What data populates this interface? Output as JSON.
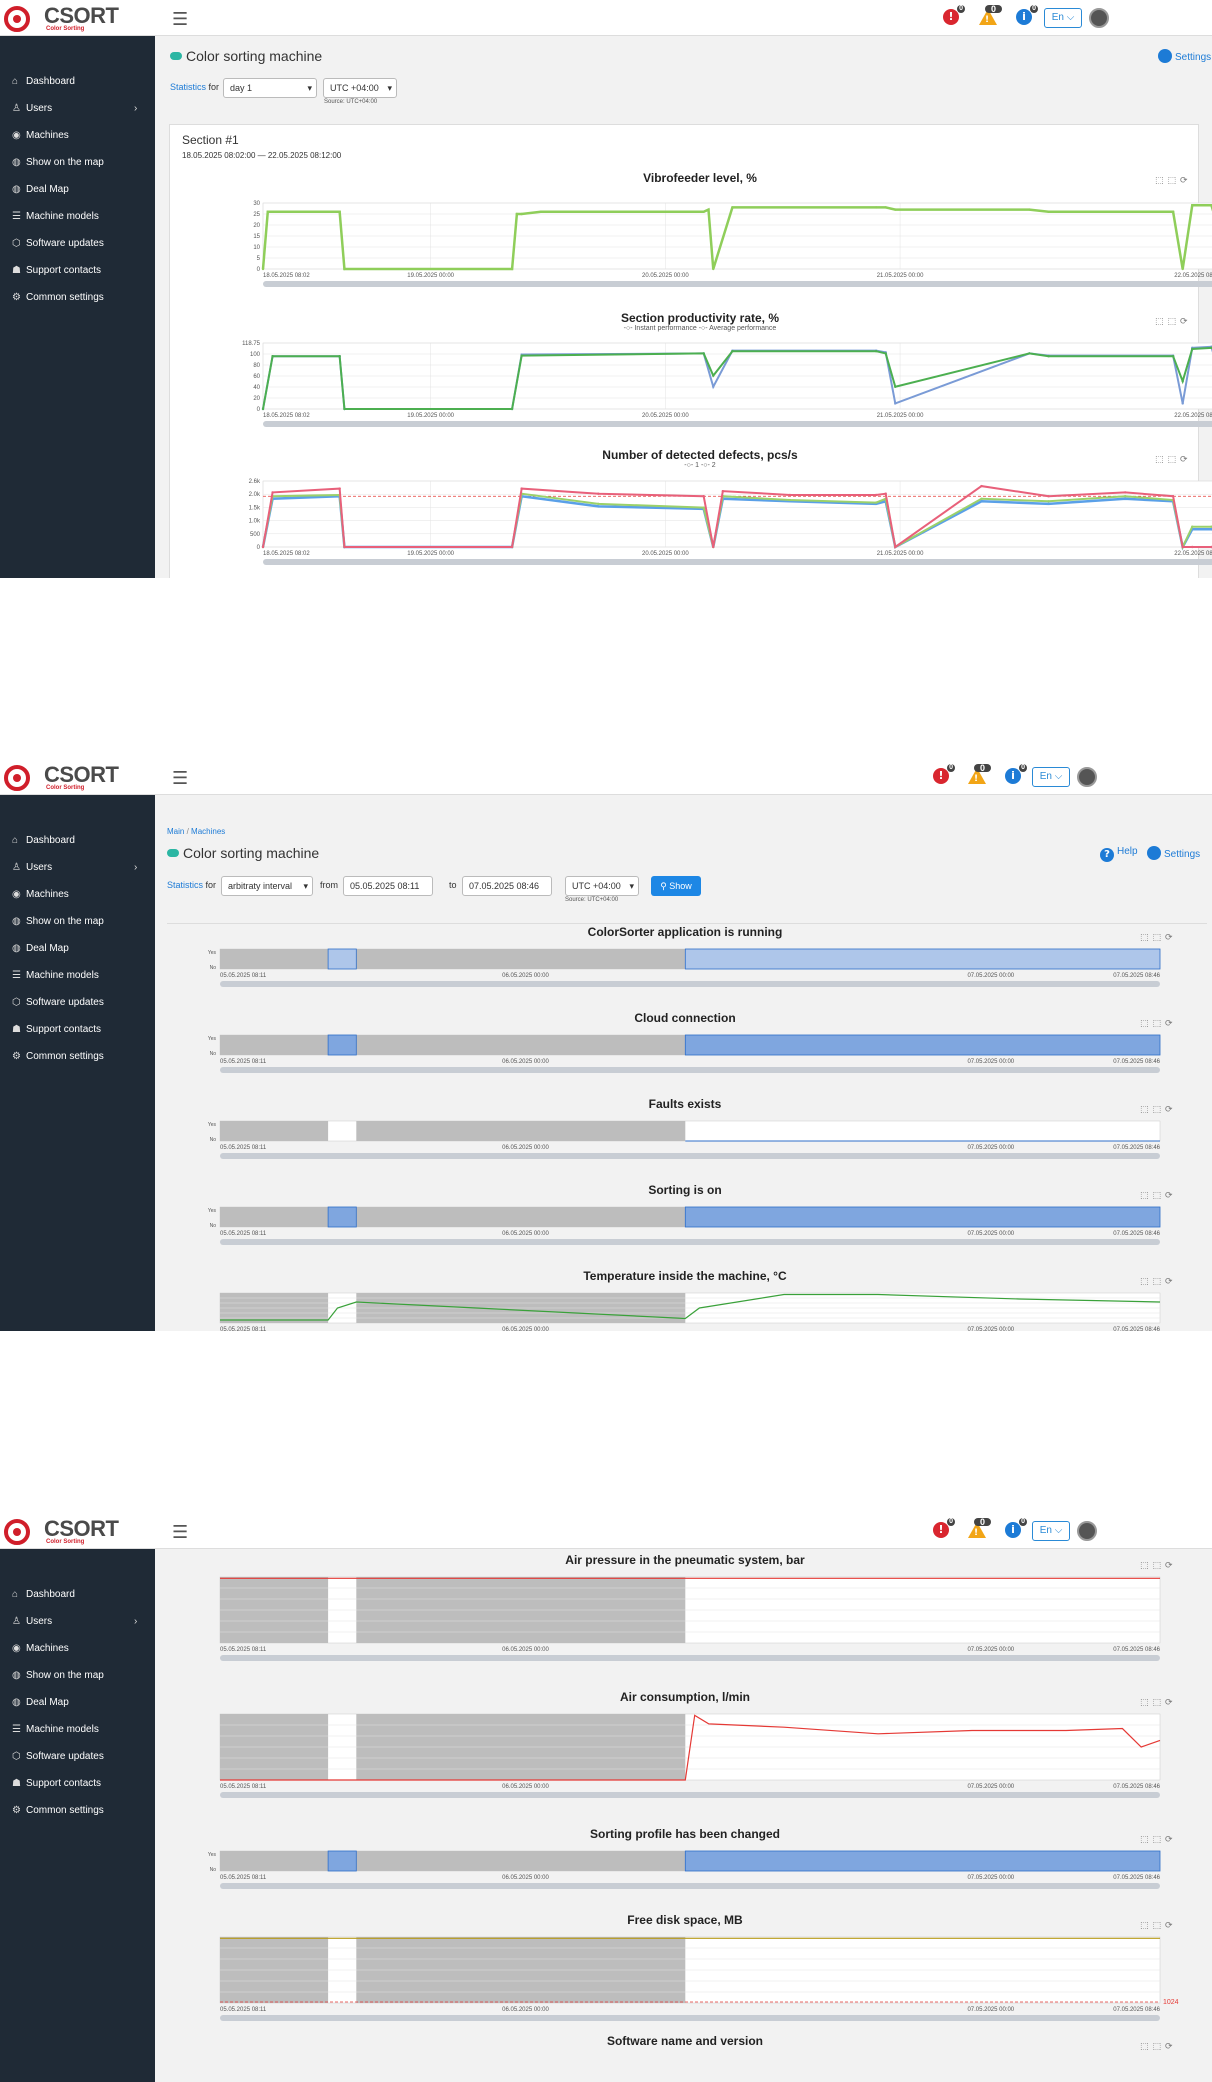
{
  "app": {
    "logo_name": "CSORT",
    "logo_sub": "Color Sorting",
    "nav": [
      "Dashboard",
      "Users",
      "Machines",
      "Show on the map",
      "Deal Map",
      "Machine models",
      "Software updates",
      "Support contacts",
      "Common settings"
    ],
    "header": {
      "lang": "En ⌵",
      "err_count": "0",
      "warn_count": "0",
      "info_count": "0"
    }
  },
  "shot1": {
    "title": "Color sorting machine",
    "settings": "Settings",
    "stats_link": "Statistics",
    "for": "for",
    "period": "day 1",
    "tz": "UTC +04:00",
    "source": "Source: UTC+04:00",
    "section": "Section #1",
    "range": "18.05.2025 08:02:00 — 22.05.2025 08:12:00",
    "charts": [
      {
        "title": "Vibrofeeder level, %",
        "legend": ""
      },
      {
        "title": "Section productivity rate, %",
        "legend": "-○- Instant performance  -○- Average performance"
      },
      {
        "title": "Number of detected defects, pcs/s",
        "legend": "-○- 1  -○- 2"
      }
    ]
  },
  "shot2": {
    "crumb_main": "Main",
    "crumb_sep": "/",
    "crumb_machines": "Machines",
    "title": "Color sorting machine",
    "help": "Help",
    "settings": "Settings",
    "stats_link": "Statistics",
    "for": "for",
    "period": "arbitraty interval",
    "from_label": "from",
    "from": "05.05.2025 08:11",
    "to_label": "to",
    "to": "07.05.2025 08:46",
    "tz": "UTC +04:00",
    "show": "Show",
    "source": "Source: UTC+04:00",
    "charts": [
      {
        "title": "ColorSorter application is running"
      },
      {
        "title": "Cloud connection"
      },
      {
        "title": "Faults exists"
      },
      {
        "title": "Sorting is on"
      },
      {
        "title": "Temperature inside the machine, °C"
      }
    ]
  },
  "shot3": {
    "charts": [
      {
        "title": "Air pressure in the pneumatic system, bar"
      },
      {
        "title": "Air consumption, l/min"
      },
      {
        "title": "Sorting profile has been changed"
      },
      {
        "title": "Free disk space, MB"
      },
      {
        "title": "Software name and version"
      }
    ]
  },
  "chart_data": [
    {
      "type": "line",
      "title": "Vibrofeeder level, %",
      "x_ticks": [
        "18.05.2025 08:02",
        "19.05.2025 00:00",
        "20.05.2025 00:00",
        "21.05.2025 00:00",
        "22.05.2025 08:12"
      ],
      "y_ticks": [
        "30",
        "25",
        "20",
        "15",
        "10",
        "5",
        "0"
      ],
      "ylim": [
        0,
        30
      ],
      "series": [
        {
          "color": "#8fce5a",
          "x": [
            0,
            0.5,
            1,
            8,
            8.5,
            26,
            26.5,
            27,
            29,
            46,
            46.5,
            47,
            49,
            64,
            65,
            66,
            80,
            82,
            95,
            96,
            97,
            99,
            100
          ],
          "values": [
            0,
            26,
            26,
            26,
            0,
            0,
            25,
            25,
            26,
            26,
            27,
            0,
            28,
            28,
            28,
            27,
            27,
            26,
            26,
            0,
            29,
            29,
            14
          ]
        }
      ]
    },
    {
      "type": "line",
      "title": "Section productivity rate, %",
      "x_ticks": [
        "18.05.2025 08:02",
        "19.05.2025 00:00",
        "20.05.2025 00:00",
        "21.05.2025 00:00",
        "22.05.2025 08:12"
      ],
      "y_ticks": [
        "118.75",
        "100",
        "80",
        "60",
        "40",
        "20",
        "0"
      ],
      "ylim": [
        0,
        118.75
      ],
      "series": [
        {
          "name": "Instant performance",
          "color": "#7a9bd6",
          "x": [
            0,
            1,
            8,
            8.5,
            26,
            27,
            46,
            47,
            49,
            64,
            65,
            66,
            80,
            82,
            95,
            96,
            97,
            99,
            100
          ],
          "values": [
            0,
            95,
            95,
            0,
            0,
            98,
            100,
            40,
            105,
            105,
            102,
            10,
            100,
            96,
            96,
            10,
            110,
            112,
            50
          ]
        },
        {
          "name": "Average performance",
          "color": "#4caf50",
          "x": [
            0,
            1,
            8,
            8.5,
            26,
            27,
            46,
            47,
            49,
            64,
            65,
            66,
            80,
            82,
            95,
            96,
            97,
            99,
            100
          ],
          "values": [
            0,
            95,
            95,
            0,
            0,
            96,
            100,
            60,
            104,
            104,
            100,
            40,
            100,
            95,
            95,
            50,
            108,
            110,
            108
          ]
        }
      ]
    },
    {
      "type": "line",
      "title": "Number of detected defects, pcs/s",
      "x_ticks": [
        "18.05.2025 08:02",
        "19.05.2025 00:00",
        "20.05.2025 00:00",
        "21.05.2025 00:00",
        "22.05.2025 08:12"
      ],
      "y_ticks": [
        "2.6k",
        "2.0k",
        "1.5k",
        "1.0k",
        "500",
        "0"
      ],
      "ylim": [
        0,
        2600
      ],
      "threshold": 2000,
      "threshold_label": "2000",
      "series": [
        {
          "name": "1",
          "color": "#5aa0e8",
          "x": [
            0,
            1,
            8,
            8.5,
            26,
            27,
            35,
            46,
            47,
            48,
            55,
            64,
            65,
            66,
            75,
            82,
            90,
            95,
            96,
            97,
            99,
            100
          ],
          "values": [
            0,
            1900,
            2000,
            0,
            0,
            2000,
            1600,
            1500,
            0,
            1900,
            1800,
            1700,
            1800,
            0,
            1800,
            1700,
            1900,
            1800,
            0,
            700,
            700,
            600
          ]
        },
        {
          "name": "2",
          "color": "#9bd16a",
          "x": [
            0,
            1,
            8,
            8.5,
            26,
            27,
            35,
            46,
            47,
            48,
            55,
            64,
            65,
            66,
            75,
            82,
            90,
            95,
            96,
            97,
            99,
            100
          ],
          "values": [
            0,
            2000,
            2050,
            0,
            0,
            2100,
            1700,
            1550,
            0,
            2000,
            1850,
            1750,
            1900,
            0,
            1900,
            1800,
            2000,
            1850,
            0,
            800,
            800,
            700
          ]
        },
        {
          "name": "",
          "color": "#e8607a",
          "x": [
            0,
            1,
            8,
            8.5,
            26,
            27,
            35,
            46,
            47,
            48,
            55,
            64,
            65,
            66,
            75,
            82,
            90,
            95,
            96,
            97,
            99,
            100
          ],
          "values": [
            0,
            2150,
            2300,
            0,
            0,
            2300,
            2100,
            2000,
            0,
            2200,
            2050,
            2050,
            2100,
            0,
            2400,
            2000,
            2150,
            2000,
            0,
            0,
            0,
            0
          ]
        }
      ]
    }
  ]
}
